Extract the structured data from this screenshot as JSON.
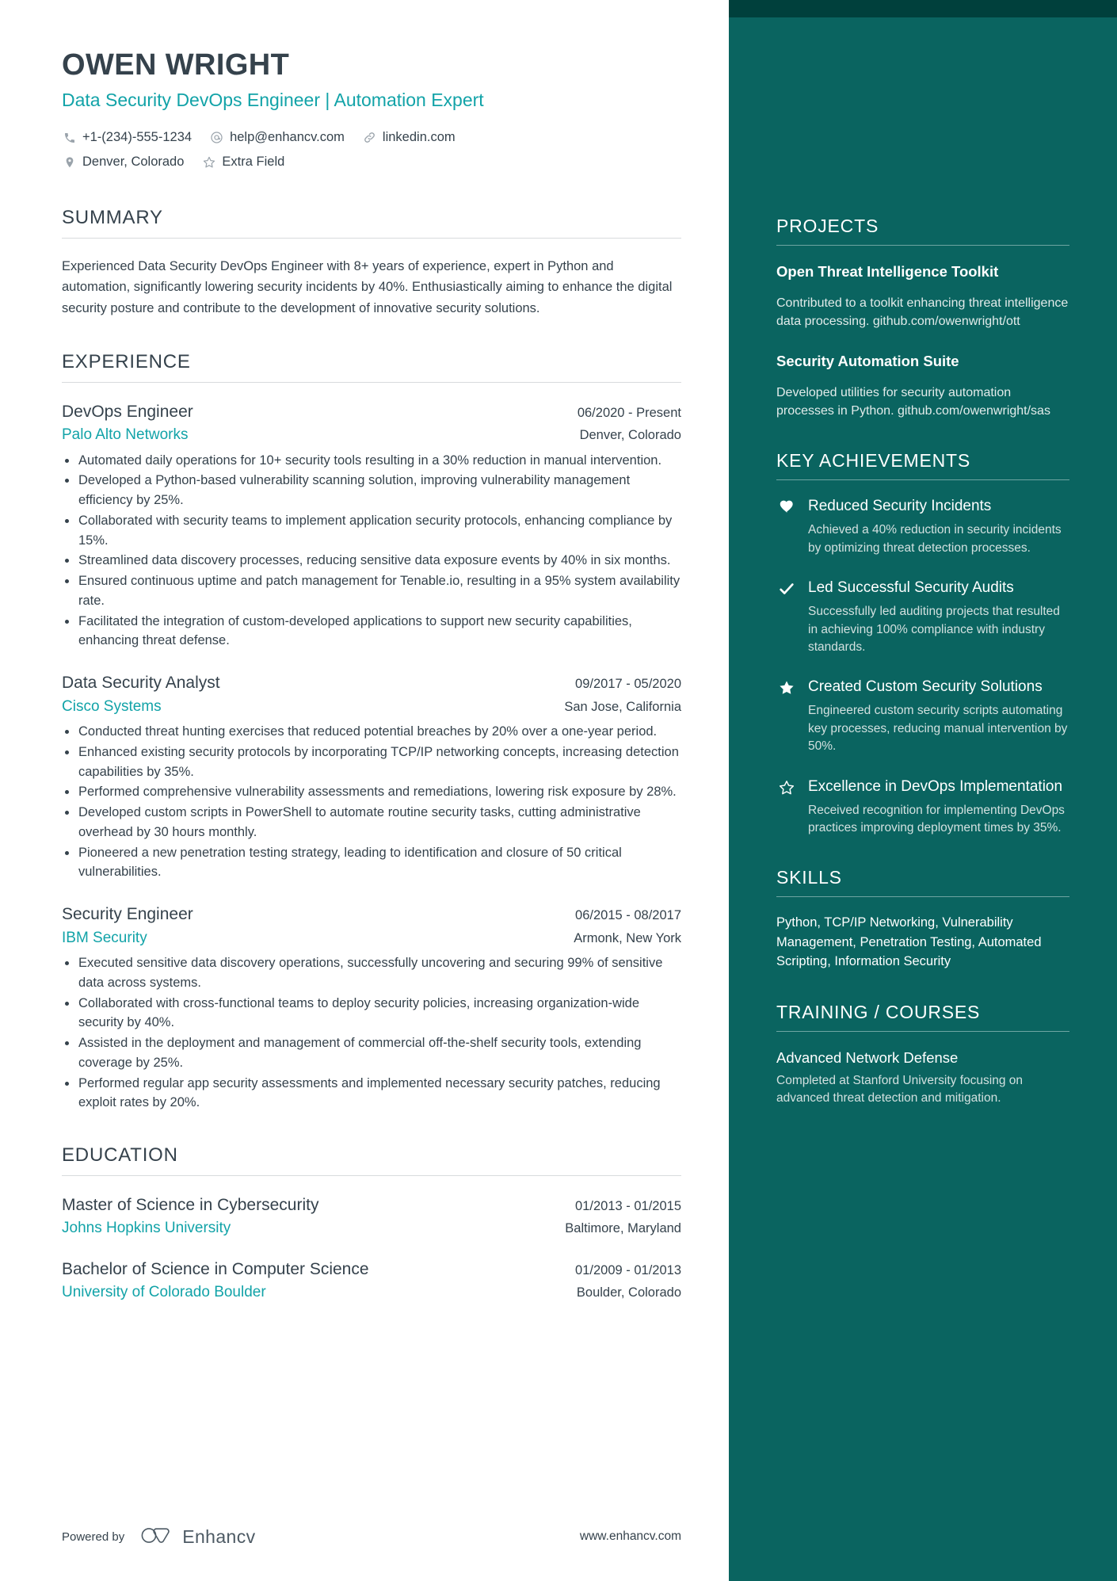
{
  "colors": {
    "accent_teal": "#12a3a8",
    "sidebar_bg": "#0a6460",
    "sidebar_topbar": "#00403c",
    "text_dark": "#35424c"
  },
  "header": {
    "name": "OWEN WRIGHT",
    "job_title": "Data Security DevOps Engineer | Automation Expert",
    "contacts": [
      {
        "icon": "phone-icon",
        "text": "+1-(234)-555-1234"
      },
      {
        "icon": "email-icon",
        "text": "help@enhancv.com"
      },
      {
        "icon": "link-icon",
        "text": "linkedin.com"
      },
      {
        "icon": "location-icon",
        "text": "Denver, Colorado"
      },
      {
        "icon": "star-outline-icon",
        "text": "Extra Field"
      }
    ]
  },
  "summary": {
    "title": "SUMMARY",
    "text": "Experienced Data Security DevOps Engineer with 8+ years of experience, expert in Python and automation, significantly lowering security incidents by 40%. Enthusiastically aiming to enhance the digital security posture and contribute to the development of innovative security solutions."
  },
  "experience": {
    "title": "EXPERIENCE",
    "entries": [
      {
        "role": "DevOps Engineer",
        "date": "06/2020 - Present",
        "company": "Palo Alto Networks",
        "location": "Denver, Colorado",
        "bullets": [
          "Automated daily operations for 10+ security tools resulting in a 30% reduction in manual intervention.",
          "Developed a Python-based vulnerability scanning solution, improving vulnerability management efficiency by 25%.",
          "Collaborated with security teams to implement application security protocols, enhancing compliance by 15%.",
          "Streamlined data discovery processes, reducing sensitive data exposure events by 40% in six months.",
          "Ensured continuous uptime and patch management for Tenable.io, resulting in a 95% system availability rate.",
          "Facilitated the integration of custom-developed applications to support new security capabilities, enhancing threat defense."
        ]
      },
      {
        "role": "Data Security Analyst",
        "date": "09/2017 - 05/2020",
        "company": "Cisco Systems",
        "location": "San Jose, California",
        "bullets": [
          "Conducted threat hunting exercises that reduced potential breaches by 20% over a one-year period.",
          "Enhanced existing security protocols by incorporating TCP/IP networking concepts, increasing detection capabilities by 35%.",
          "Performed comprehensive vulnerability assessments and remediations, lowering risk exposure by 28%.",
          "Developed custom scripts in PowerShell to automate routine security tasks, cutting administrative overhead by 30 hours monthly.",
          "Pioneered a new penetration testing strategy, leading to identification and closure of 50 critical vulnerabilities."
        ]
      },
      {
        "role": "Security Engineer",
        "date": "06/2015 - 08/2017",
        "company": "IBM Security",
        "location": "Armonk, New York",
        "bullets": [
          "Executed sensitive data discovery operations, successfully uncovering and securing 99% of sensitive data across systems.",
          "Collaborated with cross-functional teams to deploy security policies, increasing organization-wide security by 40%.",
          "Assisted in the deployment and management of commercial off-the-shelf security tools, extending coverage by 25%.",
          "Performed regular app security assessments and implemented necessary security patches, reducing exploit rates by 20%."
        ]
      }
    ]
  },
  "education": {
    "title": "EDUCATION",
    "entries": [
      {
        "degree": "Master of Science in Cybersecurity",
        "date": "01/2013 - 01/2015",
        "school": "Johns Hopkins University",
        "location": "Baltimore, Maryland"
      },
      {
        "degree": "Bachelor of Science in Computer Science",
        "date": "01/2009 - 01/2013",
        "school": "University of Colorado Boulder",
        "location": "Boulder, Colorado"
      }
    ]
  },
  "footer": {
    "powered_by": "Powered by",
    "brand": "Enhancv",
    "url": "www.enhancv.com"
  },
  "sidebar": {
    "projects": {
      "title": "PROJECTS",
      "items": [
        {
          "title": "Open Threat Intelligence Toolkit",
          "desc": "Contributed to a toolkit enhancing threat intelligence data processing. github.com/owenwright/ott"
        },
        {
          "title": "Security Automation Suite",
          "desc": "Developed utilities for security automation processes in Python. github.com/owenwright/sas"
        }
      ]
    },
    "achievements": {
      "title": "KEY ACHIEVEMENTS",
      "items": [
        {
          "icon": "heart-icon",
          "title": "Reduced Security Incidents",
          "desc": "Achieved a 40% reduction in security incidents by optimizing threat detection processes."
        },
        {
          "icon": "check-icon",
          "title": "Led Successful Security Audits",
          "desc": "Successfully led auditing projects that resulted in achieving 100% compliance with industry standards."
        },
        {
          "icon": "star-filled-icon",
          "title": "Created Custom Security Solutions",
          "desc": "Engineered custom security scripts automating key processes, reducing manual intervention by 50%."
        },
        {
          "icon": "star-outline-icon",
          "title": "Excellence in DevOps Implementation",
          "desc": "Received recognition for implementing DevOps practices improving deployment times by 35%."
        }
      ]
    },
    "skills": {
      "title": "SKILLS",
      "text": "Python, TCP/IP Networking, Vulnerability Management, Penetration Testing, Automated Scripting, Information Security"
    },
    "training": {
      "title": "TRAINING / COURSES",
      "items": [
        {
          "title": "Advanced Network Defense",
          "desc": "Completed at Stanford University focusing on advanced threat detection and mitigation."
        }
      ]
    }
  }
}
